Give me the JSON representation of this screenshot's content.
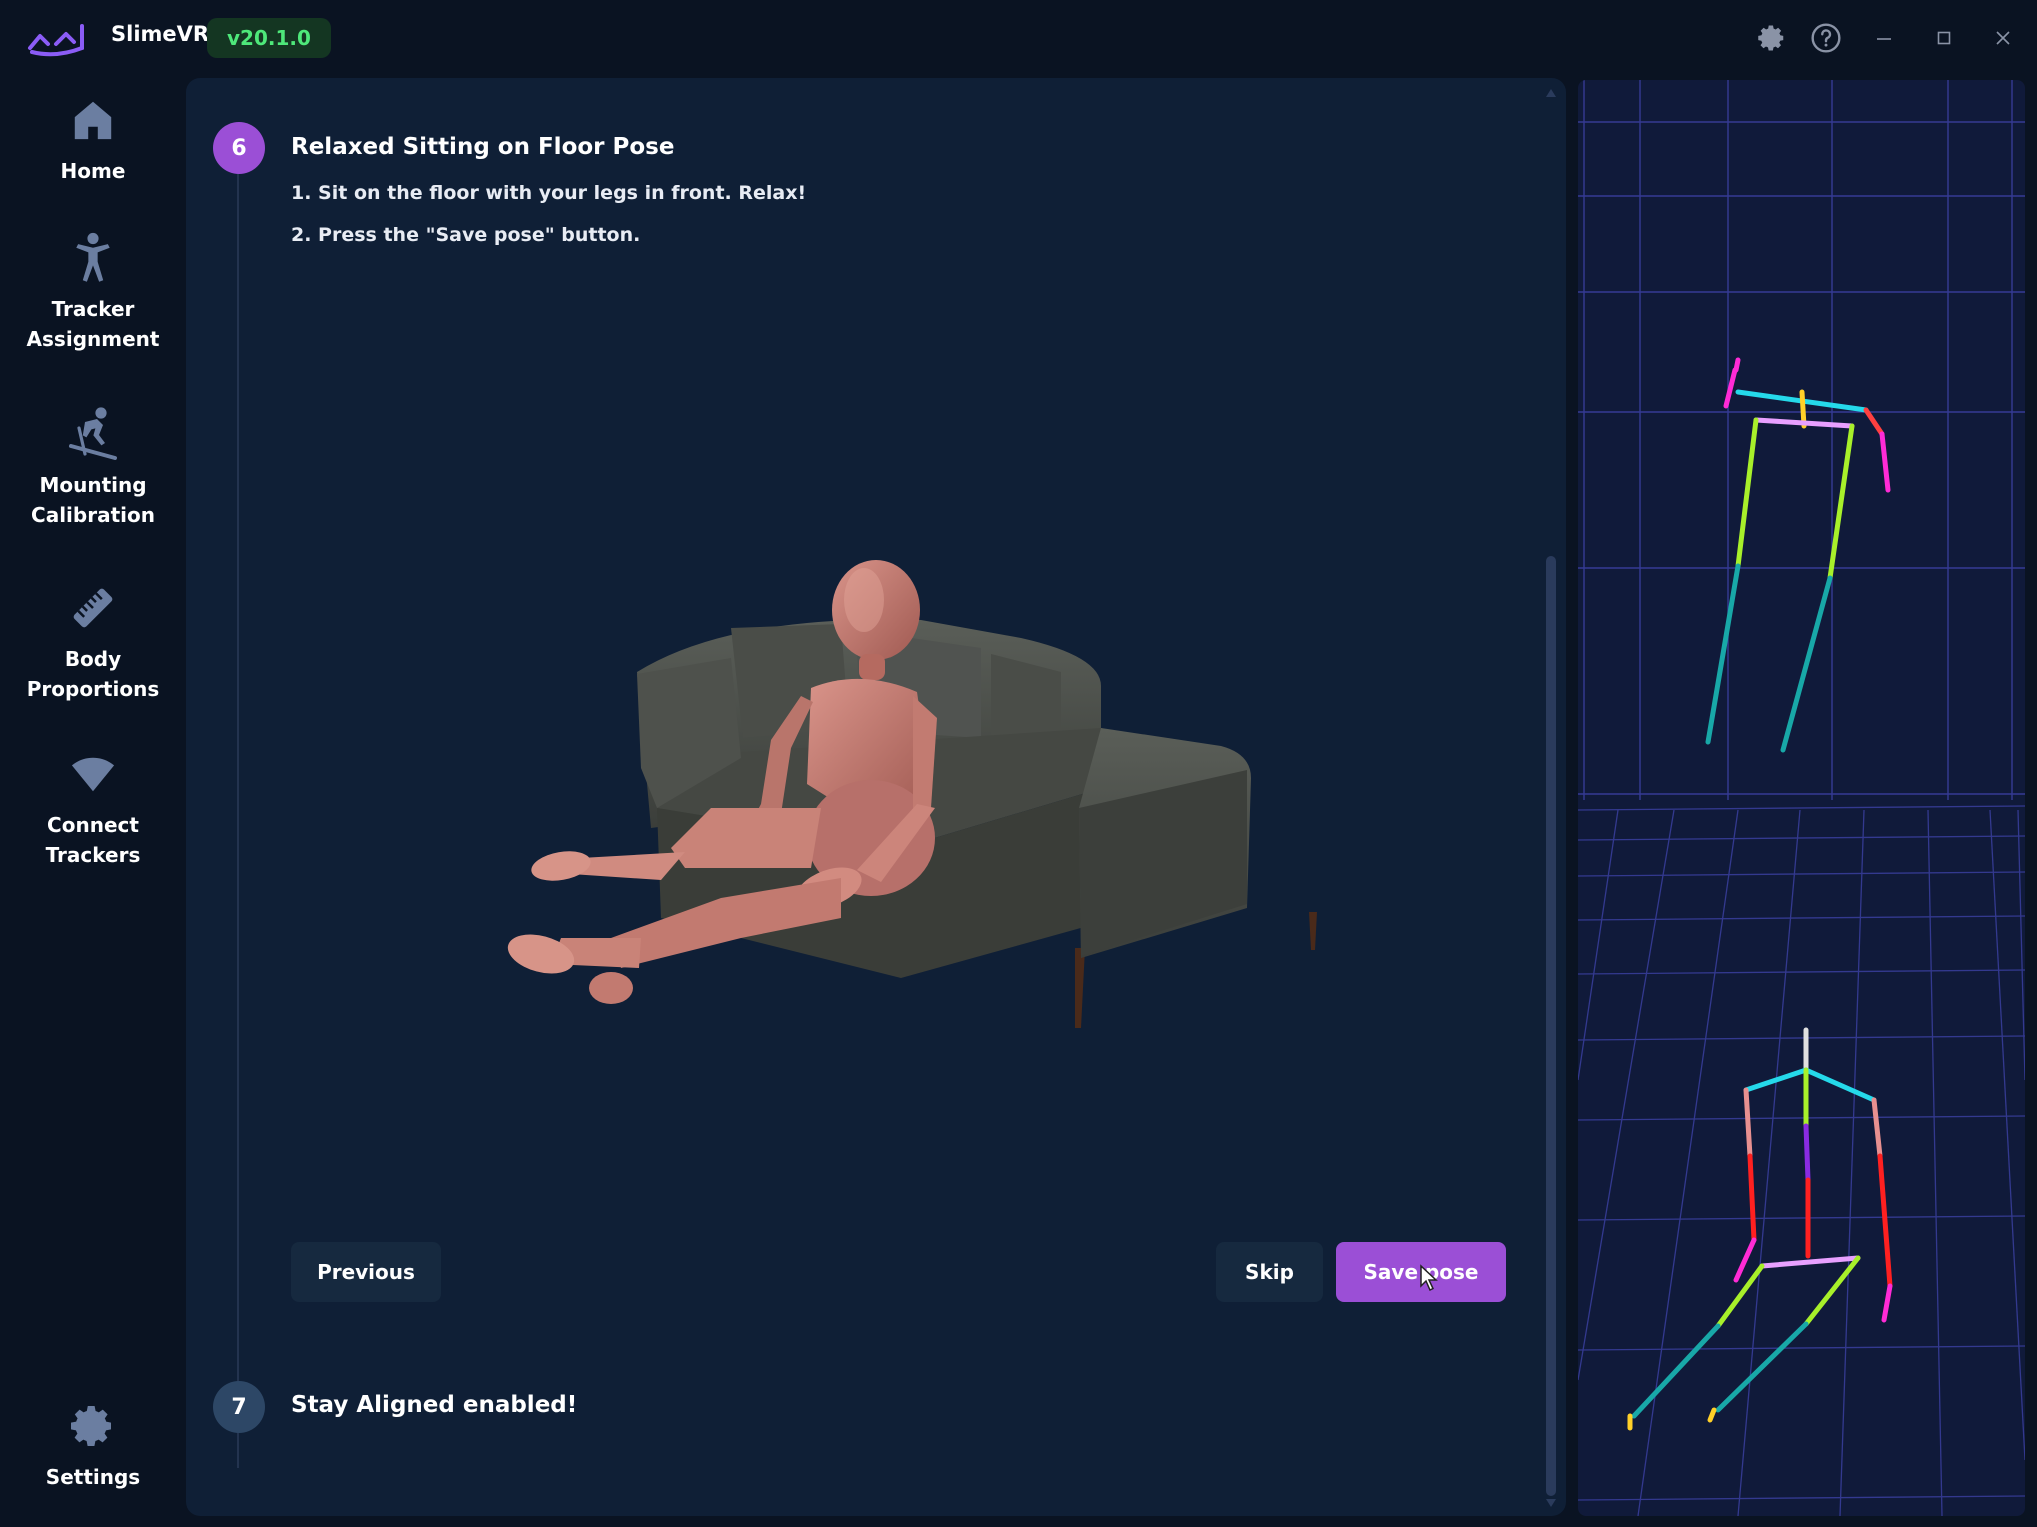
{
  "titlebar": {
    "app_name": "SlimeVR",
    "version": "v20.1.0",
    "icons": [
      "settings-gear-icon",
      "help-icon",
      "minimize-icon",
      "maximize-icon",
      "close-icon"
    ]
  },
  "sidebar": {
    "items": [
      {
        "label": "Home",
        "icon": "home-icon"
      },
      {
        "label": "Tracker\nAssignment",
        "icon": "person-icon"
      },
      {
        "label": "Mounting\nCalibration",
        "icon": "skier-icon"
      },
      {
        "label": "Body\nProportions",
        "icon": "ruler-icon"
      },
      {
        "label": "Connect\nTrackers",
        "icon": "wifi-icon"
      }
    ],
    "settings": {
      "label": "Settings",
      "icon": "gear-icon"
    }
  },
  "steps": {
    "current": {
      "number": "6",
      "title": "Relaxed Sitting on Floor Pose",
      "instructions": [
        "1. Sit on the floor with your legs in front. Relax!",
        "2. Press the \"Save pose\" button."
      ]
    },
    "next": {
      "number": "7",
      "title": "Stay Aligned enabled!"
    }
  },
  "buttons": {
    "previous": "Previous",
    "skip": "Skip",
    "save": "Save pose"
  },
  "colors": {
    "accent_purple": "#9b4fd6",
    "version_green": "#4ee87a",
    "panel": "#0f1f36",
    "background": "#0a1322"
  }
}
